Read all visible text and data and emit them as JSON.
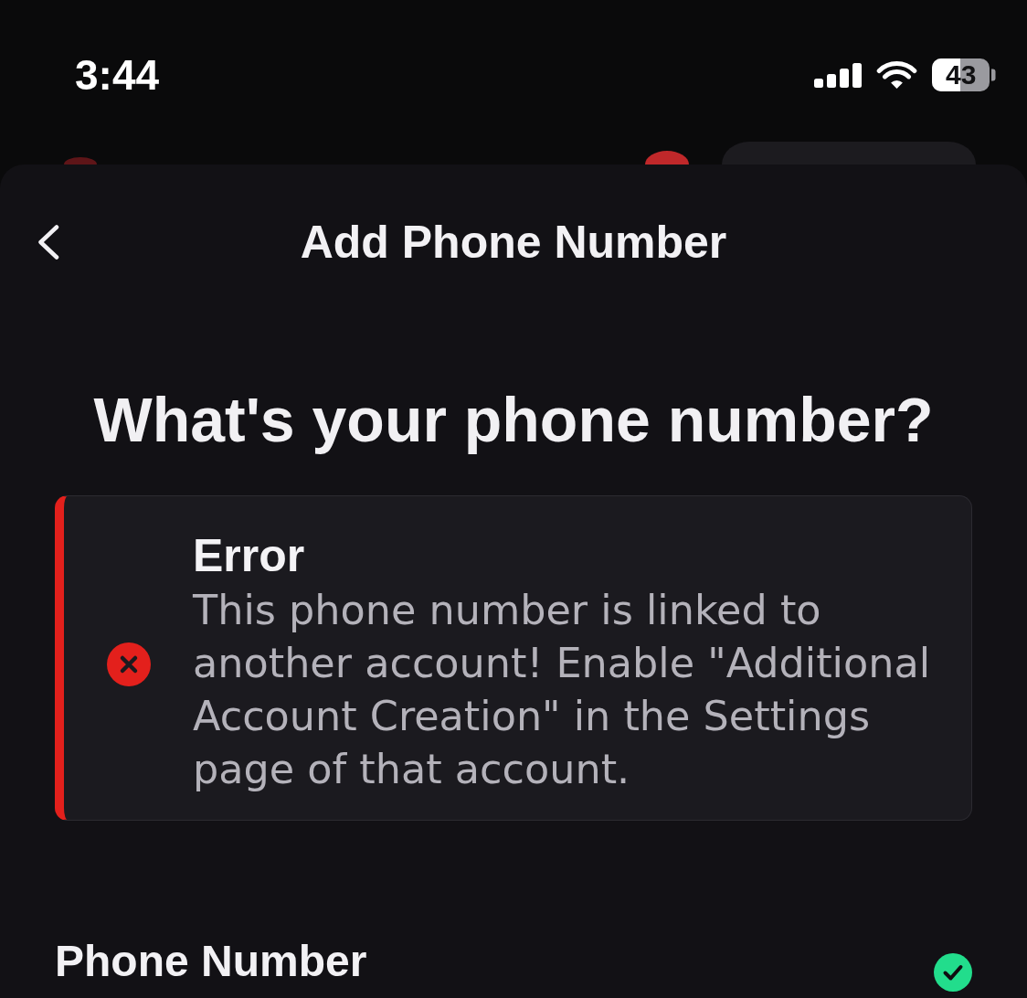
{
  "status_bar": {
    "time": "3:44",
    "battery": "43"
  },
  "sheet": {
    "title": "Add Phone Number",
    "heading": "What's your phone number?",
    "alert": {
      "kind": "error",
      "title": "Error",
      "message": "This phone number is linked to another account! Enable \"Additional Account Creation\" in the Settings page of that account."
    },
    "field": {
      "label": "Phone Number",
      "valid": true
    }
  }
}
